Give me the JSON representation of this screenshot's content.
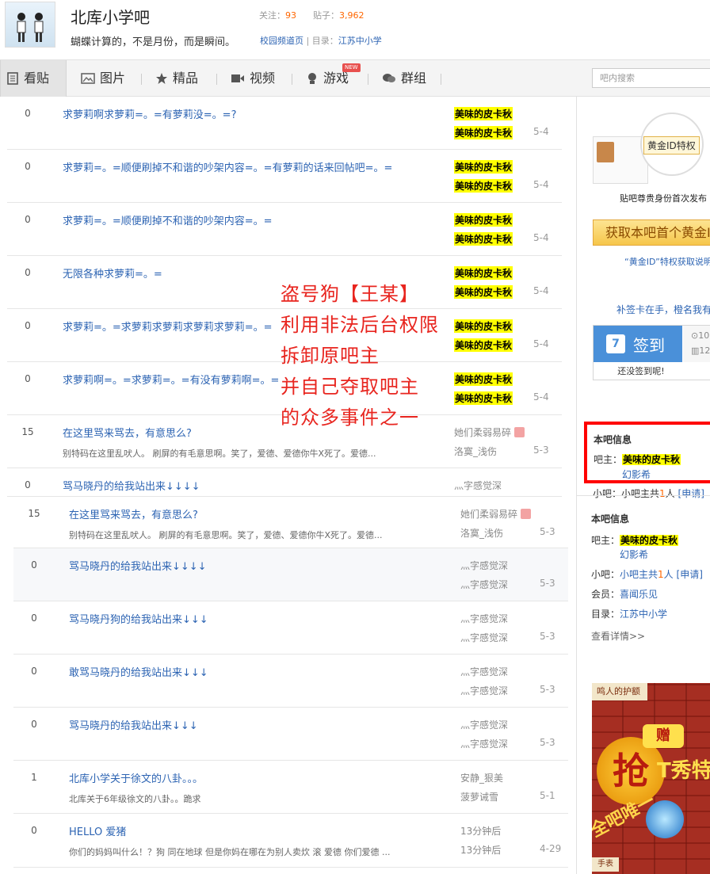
{
  "header": {
    "bar_name": "北库小学吧",
    "follow_label": "关注：",
    "follow_count": "93",
    "posts_label": "贴子：",
    "posts_count": "3,962",
    "slogan": "蝴蝶计算的，不是月份，而是瞬间。",
    "link_campus": "校园频道页",
    "sep": " | ",
    "category_label": "目录：",
    "category_link": "江苏中小学"
  },
  "nav": {
    "tabs": [
      {
        "label": "看贴",
        "icon": "document-icon"
      },
      {
        "label": "图片",
        "icon": "image-icon"
      },
      {
        "label": "精品",
        "icon": "star-icon"
      },
      {
        "label": "视频",
        "icon": "video-icon"
      },
      {
        "label": "游戏",
        "icon": "game-icon"
      },
      {
        "label": "群组",
        "icon": "chat-icon"
      }
    ],
    "new_badge": "NEW",
    "search_placeholder": "吧内搜索"
  },
  "threads": [
    {
      "count": "0",
      "title": "求萝莉啊求萝莉=。=有萝莉没=。=?",
      "excerpt": "",
      "author1": "美味的皮卡秋",
      "author2": "美味的皮卡秋",
      "date": "5-4",
      "hl": true
    },
    {
      "count": "0",
      "title": "求萝莉=。=顺便刷掉不和谐的吵架内容=。=有萝莉的话来回帖吧=。=",
      "excerpt": "",
      "author1": "美味的皮卡秋",
      "author2": "美味的皮卡秋",
      "date": "5-4",
      "hl": true
    },
    {
      "count": "0",
      "title": "求萝莉=。=顺便刷掉不和谐的吵架内容=。=",
      "excerpt": "",
      "author1": "美味的皮卡秋",
      "author2": "美味的皮卡秋",
      "date": "5-4",
      "hl": true
    },
    {
      "count": "0",
      "title": "无限各种求萝莉=。=",
      "excerpt": "",
      "author1": "美味的皮卡秋",
      "author2": "美味的皮卡秋",
      "date": "5-4",
      "hl": true
    },
    {
      "count": "0",
      "title": "求萝莉=。=求萝莉求萝莉求萝莉求萝莉=。=",
      "excerpt": "",
      "author1": "美味的皮卡秋",
      "author2": "美味的皮卡秋",
      "date": "5-4",
      "hl": true
    },
    {
      "count": "0",
      "title": "求萝莉啊=。=求萝莉=。=有没有萝莉啊=。=",
      "excerpt": "",
      "author1": "美味的皮卡秋",
      "author2": "美味的皮卡秋",
      "date": "5-4",
      "hl": true
    },
    {
      "count": "15",
      "title": "在这里骂来骂去，有意思么?",
      "excerpt": "别特码在这里乱吠人。  刷屏的有毛意思啊。笑了，爱德、爱德你牛X死了。爱德...",
      "author1": "她们柔弱易碎",
      "author2": "洛寞_浅伤",
      "date": "5-3",
      "hl": false
    },
    {
      "count": "0",
      "title": "骂马晓丹的给我站出来↓↓↓↓",
      "excerpt": "",
      "author1": "灬字感觉深",
      "author2": "",
      "date": "",
      "hl": false
    },
    {
      "count": "15",
      "title": "在这里骂来骂去，有意思么?",
      "excerpt": "别特码在这里乱吠人。  刷屏的有毛意思啊。笑了，爱德、爱德你牛X死了。爱德...",
      "author1": "她们柔弱易碎",
      "author2": "洛寞_浅伤",
      "date": "5-3",
      "hl": false
    },
    {
      "count": "0",
      "title": "骂马晓丹的给我站出来↓↓↓↓",
      "excerpt": "",
      "author1": "灬字感觉深",
      "author2": "灬字感觉深",
      "date": "5-3",
      "hl": false
    },
    {
      "count": "0",
      "title": "骂马晓丹狗的给我站出来↓↓↓",
      "excerpt": "",
      "author1": "灬字感觉深",
      "author2": "灬字感觉深",
      "date": "5-3",
      "hl": false
    },
    {
      "count": "0",
      "title": "敢骂马晓丹的给我站出来↓↓↓",
      "excerpt": "",
      "author1": "灬字感觉深",
      "author2": "灬字感觉深",
      "date": "5-3",
      "hl": false
    },
    {
      "count": "0",
      "title": "骂马晓丹的给我站出来↓↓↓",
      "excerpt": "",
      "author1": "灬字感觉深",
      "author2": "灬字感觉深",
      "date": "5-3",
      "hl": false
    },
    {
      "count": "1",
      "title": "北库小学关于徐文的八卦。。。",
      "excerpt": "北库关于6年级徐文的八卦。。跪求",
      "author1": "安静_狠美",
      "author2": "菠萝诫雪",
      "date": "5-1",
      "hl": false
    },
    {
      "count": "0",
      "title": "HELLO 爱猪",
      "excerpt": "你们的妈妈叫什么！？狗 同在地球 但是你妈在哪在为别人卖炊  滚 爱德 你们爱德 ...",
      "author1": "13分钟后",
      "author2": "13分钟后",
      "date": "4-29",
      "hl": false
    }
  ],
  "overlay_lines": [
    "盗号狗【王某】",
    "利用非法后台权限",
    "拆卸原吧主",
    "并自己夺取吧主",
    "的众多事件之一"
  ],
  "sidebar": {
    "gold_tag": "黄金ID特权",
    "gold_desc": "贴吧尊贵身份首次发布",
    "gold_btn": "获取本吧首个黄金ID",
    "gold_note": "“黄金ID”特权获取说明",
    "sign_tip": "补签卡在手，橙名我有",
    "sign_btn": "签到",
    "sign_side1": "10",
    "sign_side2": "12",
    "sign_status": "还没签到呢!",
    "info_title": "本吧信息",
    "owner_label": "吧主：",
    "owner_name": "美味的皮卡秋",
    "owner_name2": "幻影希",
    "small_label": "小吧：",
    "small_text": "小吧主共",
    "small_count": "1",
    "small_unit": "人",
    "apply": "[申请]",
    "member_label": "会员：",
    "member_name": "喜闻乐见",
    "category_label": "目录：",
    "category_name": "江苏中小学",
    "more": "查看详情>>"
  },
  "ad": {
    "banner": "鸣人的护额",
    "grab": "抢",
    "zeng": "赠",
    "show": "T秀特",
    "only": "全吧唯一",
    "tab": "手表"
  }
}
